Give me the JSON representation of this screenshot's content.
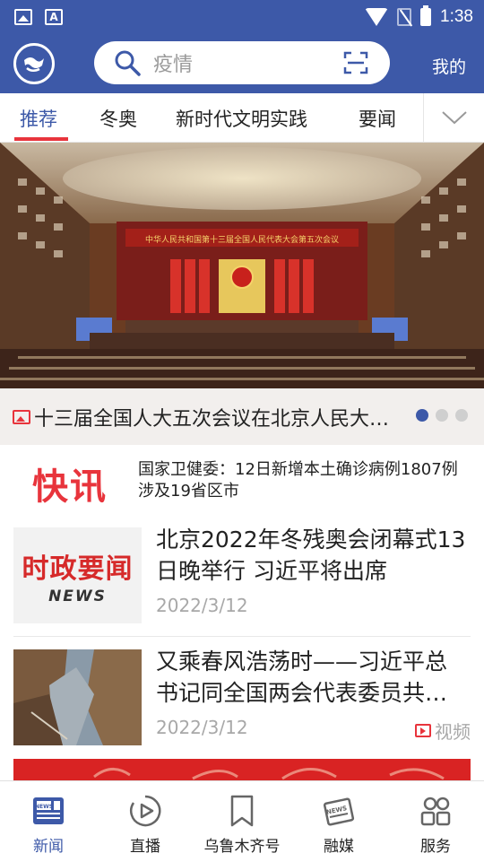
{
  "status_bar": {
    "time": "1:38",
    "font_icon_letter": "A"
  },
  "header": {
    "search_placeholder": "疫情",
    "mine_label": "我的"
  },
  "tabs": [
    {
      "label": "推荐",
      "active": true
    },
    {
      "label": "冬奥",
      "active": false
    },
    {
      "label": "新时代文明实践",
      "active": false
    },
    {
      "label": "要闻",
      "active": false
    }
  ],
  "banner": {
    "caption": "十三届全国人大五次会议在北京人民大会堂开幕",
    "slide_count": 3,
    "active_slide": 1,
    "image_text": "中华人民共和国第十三届全国人民代表大会第五次会议"
  },
  "flash": {
    "label": "快讯",
    "text": "国家卫健委：12日新增本土确诊病例1807例 涉及19省区市"
  },
  "news": [
    {
      "title": "北京2022年冬残奥会闭幕式13日晚举行 习近平将出席",
      "date": "2022/3/12",
      "thumb_big": "时政要闻",
      "thumb_small": "NEWS",
      "tag": ""
    },
    {
      "title": "又乘春风浩荡时——习近平总书记同全国两会代表委员共商国是",
      "date": "2022/3/12",
      "tag": "视频"
    }
  ],
  "bottom_nav": [
    {
      "label": "新闻",
      "icon": "newspaper-icon",
      "active": true
    },
    {
      "label": "直播",
      "icon": "play-circle-icon",
      "active": false
    },
    {
      "label": "乌鲁木齐号",
      "icon": "bookmark-icon",
      "active": false
    },
    {
      "label": "融媒",
      "icon": "news-paper-stack-icon",
      "active": false
    },
    {
      "label": "服务",
      "icon": "users-icon",
      "active": false
    }
  ],
  "colors": {
    "brand_blue": "#3d59a8",
    "accent_red": "#e8343c"
  }
}
